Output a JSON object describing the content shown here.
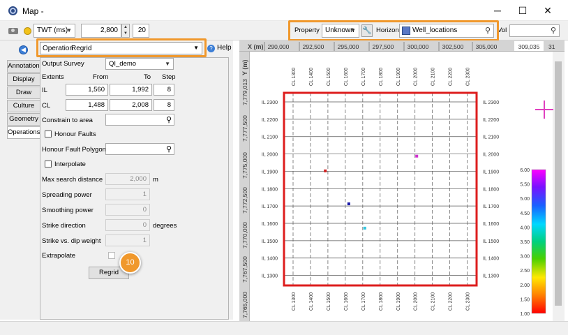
{
  "window": {
    "title": "Map -",
    "controls": {
      "minimize": "─",
      "maximize": "☐",
      "close": "✕"
    }
  },
  "toolbar": {
    "domain_value": "TWT (ms)",
    "time_value": "2,800",
    "step_value": "20",
    "property_label": "Property",
    "property_value": "Unknown",
    "horizon_label": "Horizon",
    "horizon_value": "Well_locations",
    "vol_label": "Vol"
  },
  "operation": {
    "label": "Operation",
    "value": "Regrid",
    "help_label": "Help"
  },
  "tabs": [
    "Annotation",
    "Display",
    "Draw",
    "Culture",
    "Geometry",
    "Operations"
  ],
  "form": {
    "output_survey_label": "Output Survey",
    "output_survey_value": "QI_demo",
    "extents_label": "Extents",
    "from_label": "From",
    "to_label": "To",
    "step_label": "Step",
    "il_label": "IL",
    "il_from": "1,560",
    "il_to": "1,992",
    "il_step": "8",
    "cl_label": "CL",
    "cl_from": "1,488",
    "cl_to": "2,008",
    "cl_step": "8",
    "constrain_label": "Constrain to area",
    "honour_faults_label": "Honour Faults",
    "honour_polygons_label": "Honour Fault Polygons",
    "interpolate_label": "Interpolate",
    "max_search_label": "Max search distance",
    "max_search_value": "2,000",
    "max_search_unit": "m",
    "spreading_label": "Spreading power",
    "spreading_value": "1",
    "smoothing_label": "Smoothing power",
    "smoothing_value": "0",
    "strike_dir_label": "Strike direction",
    "strike_dir_value": "0",
    "strike_dir_unit": "degrees",
    "strike_weight_label": "Strike vs. dip weight",
    "strike_weight_value": "1",
    "extrapolate_label": "Extrapolate",
    "regrid_button": "Regrid",
    "step_badge": "10"
  },
  "map": {
    "x_ruler_label": "X (m)",
    "x_ticks": [
      "290,000",
      "292,500",
      "295,000",
      "297,500",
      "300,000",
      "302,500",
      "305,000"
    ],
    "x_cursor_readout": "309,035",
    "x_edge_text": "31",
    "y_ruler_label": "Y (m)",
    "y_ticks": [
      "7,779,013",
      "7,777,500",
      "7,775,000",
      "7,772,500",
      "7,770,000",
      "7,767,500",
      "7,765,000"
    ],
    "cl_labels": [
      "CL 1300",
      "CL 1400",
      "CL 1500",
      "CL 1600",
      "CL 1700",
      "CL 1800",
      "CL 1900",
      "CL 2000",
      "CL 2100",
      "CL 2200",
      "CL 2300"
    ],
    "il_labels": [
      "IL 2300",
      "IL 2200",
      "IL 2100",
      "IL 2000",
      "IL 1900",
      "IL 1800",
      "IL 1700",
      "IL 1600",
      "IL 1500",
      "IL 1400",
      "IL 1300"
    ],
    "wells": [
      {
        "cl": 1485,
        "il": 1900,
        "color": "#d02020"
      },
      {
        "cl": 1620,
        "il": 1710,
        "color": "#1a1aa8"
      },
      {
        "cl": 1712,
        "il": 1570,
        "color": "#33c6e0"
      },
      {
        "cl": 2010,
        "il": 1985,
        "color": "#d030d0"
      }
    ],
    "colorbar": {
      "ticks": [
        "6.00",
        "5.50",
        "5.00",
        "4.50",
        "4.00",
        "3.50",
        "3.00",
        "2.50",
        "2.00",
        "1.50",
        "1.00"
      ],
      "min": 1.0,
      "max": 6.0
    },
    "region_color": "#dd1d1d",
    "crosshair_color": "#e040c0"
  },
  "colors": {
    "highlight": "#f0982c",
    "accent": "#3b7ed6"
  }
}
